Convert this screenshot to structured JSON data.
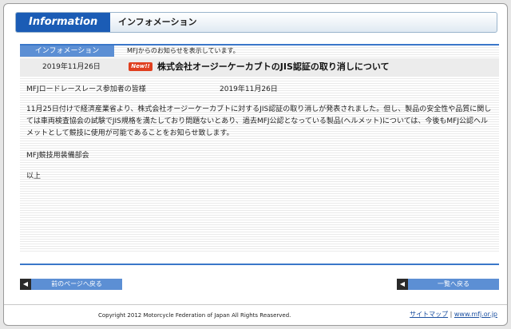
{
  "header": {
    "tab_label": "Information",
    "title": "インフォメーション"
  },
  "subhead": {
    "tab_label": "インフォメーション",
    "description": "MFJからのお知らせを表示しています。"
  },
  "news": {
    "date": "2019年11月26日",
    "badge": "New!!",
    "title": "株式会社オージーケーカブトのJIS認証の取り消しについて"
  },
  "article": {
    "addressee": "MFJロードレースレース参加者の皆様",
    "date": "2019年11月26日",
    "paragraph": "11月25日付けで経済産業省より、株式会社オージーケーカブトに対するJIS認証の取り消しが発表されました。但し、製品の安全性や品質に関しては車両検査協会の試験でJIS規格を満たしており問題ないとあり、過去MFJ公認となっている製品(ヘルメット)については、今後もMFJ公認ヘルメットとして競技に使用が可能であることをお知らせ致します。",
    "signature": "MFJ競技用装備部会",
    "closing": "以上"
  },
  "nav": {
    "prev_label": "前のページへ戻る",
    "list_label": "一覧へ戻る",
    "arrow_glyph": "◀"
  },
  "footer": {
    "copyright": "Copyright 2012 Motorcycle Federation of Japan All Rights Reaserved.",
    "sitemap": "サイトマップ",
    "separator": "|",
    "site_url": "www.mfj.or.jp"
  },
  "colors": {
    "accent_blue": "#1b5cb5",
    "tab_blue": "#5c8fd4",
    "badge_red": "#e04020"
  }
}
